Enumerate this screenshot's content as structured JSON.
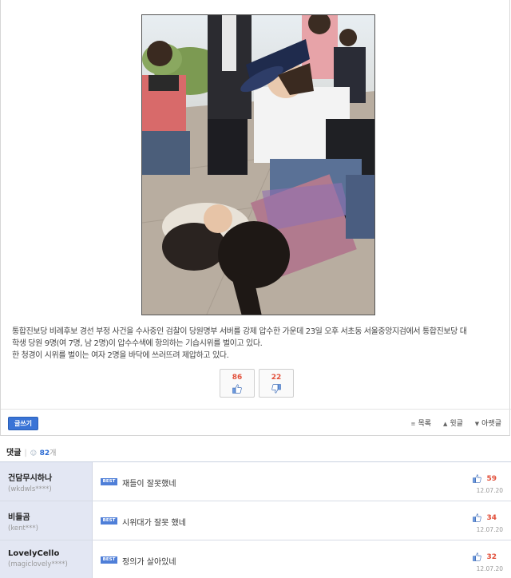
{
  "post": {
    "body_line1": "통합진보당 비례후보 경선 부정 사건을 수사중인 검찰이 당원명부 서버를 강제 압수한 가운데 23일 오후 서초동 서울중앙지검에서 통합진보당 대",
    "body_line2": "학생 당원 9명(여 7명, 남 2명)이 압수수색에 항의하는 기습시위를 벌이고 있다.",
    "body_line3": "한 청경이 시위를 벌이는 여자 2명을 바닥에 쓰러뜨려 제압하고 있다.",
    "upvotes": "86",
    "downvotes": "22"
  },
  "toolbar": {
    "write_label": "글쓰기",
    "list_label": "목록",
    "prev_label": "윗글",
    "next_label": "아랫글"
  },
  "comments": {
    "header": "댓글",
    "count": "82",
    "count_unit": "개",
    "items": [
      {
        "nick": "건담무시하나",
        "uid": "(wkdwls****)",
        "badge": "BEST",
        "text": "재들이 잘못했네",
        "likes": "59",
        "date": "12.07.20"
      },
      {
        "nick": "비들곰",
        "uid": "(kent***)",
        "badge": "BEST",
        "text": "시위대가 잘못 했네",
        "likes": "34",
        "date": "12.07.20"
      },
      {
        "nick": "LovelyCello",
        "uid": "(magiclovely****)",
        "badge": "BEST",
        "text": "정의가 살아있네",
        "likes": "32",
        "date": "12.07.20"
      }
    ]
  },
  "icons": {
    "thumb_up": "thumbs-up-icon",
    "thumb_down": "thumbs-down-icon",
    "list": "list-icon",
    "prev": "triangle-up-icon",
    "next": "triangle-down-icon"
  },
  "colors": {
    "accent": "#3a74d6",
    "vote_count": "#e2503b",
    "author_bg": "#e3e7f3"
  }
}
